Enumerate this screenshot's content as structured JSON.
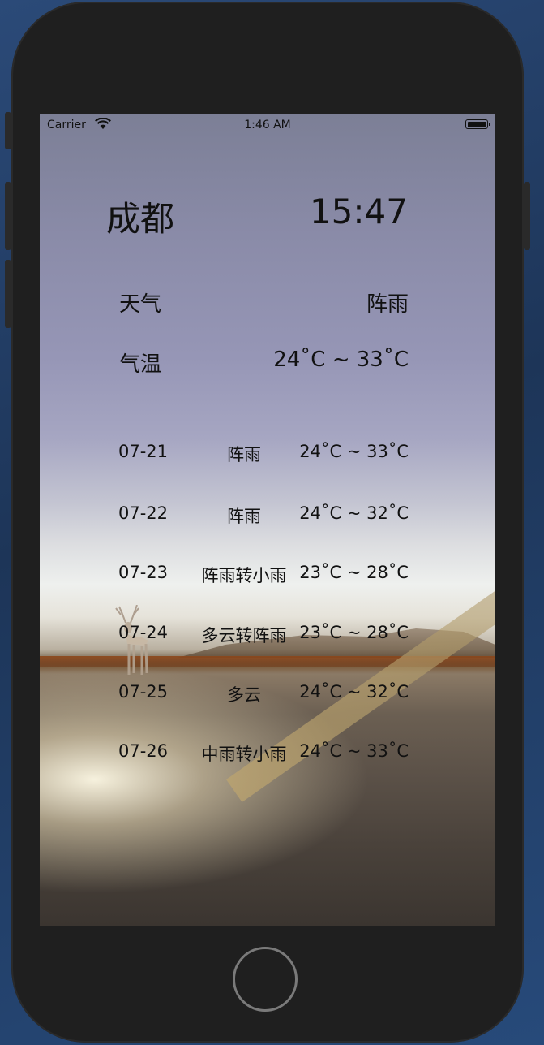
{
  "status_bar": {
    "carrier": "Carrier",
    "time": "1:46 AM"
  },
  "header": {
    "city": "成都",
    "time": "15:47"
  },
  "current": {
    "weather_label": "天气",
    "weather_value": "阵雨",
    "temp_label": "气温",
    "temp_value": "24˚C ~ 33˚C"
  },
  "forecast": [
    {
      "date": "07-21",
      "weather": "阵雨",
      "temp": "24˚C ~ 33˚C"
    },
    {
      "date": "07-22",
      "weather": "阵雨",
      "temp": "24˚C ~ 32˚C"
    },
    {
      "date": "07-23",
      "weather": "阵雨转小雨",
      "temp": "23˚C ~ 28˚C"
    },
    {
      "date": "07-24",
      "weather": "多云转阵雨",
      "temp": "23˚C ~ 28˚C"
    },
    {
      "date": "07-25",
      "weather": "多云",
      "temp": "24˚C ~ 32˚C"
    },
    {
      "date": "07-26",
      "weather": "中雨转小雨",
      "temp": "24˚C ~ 33˚C"
    }
  ],
  "icons": {
    "wifi": "wifi-icon",
    "battery": "battery-icon",
    "home": "home-button"
  },
  "colors": {
    "text": "#111111",
    "bezel": "#1f1f1f"
  }
}
